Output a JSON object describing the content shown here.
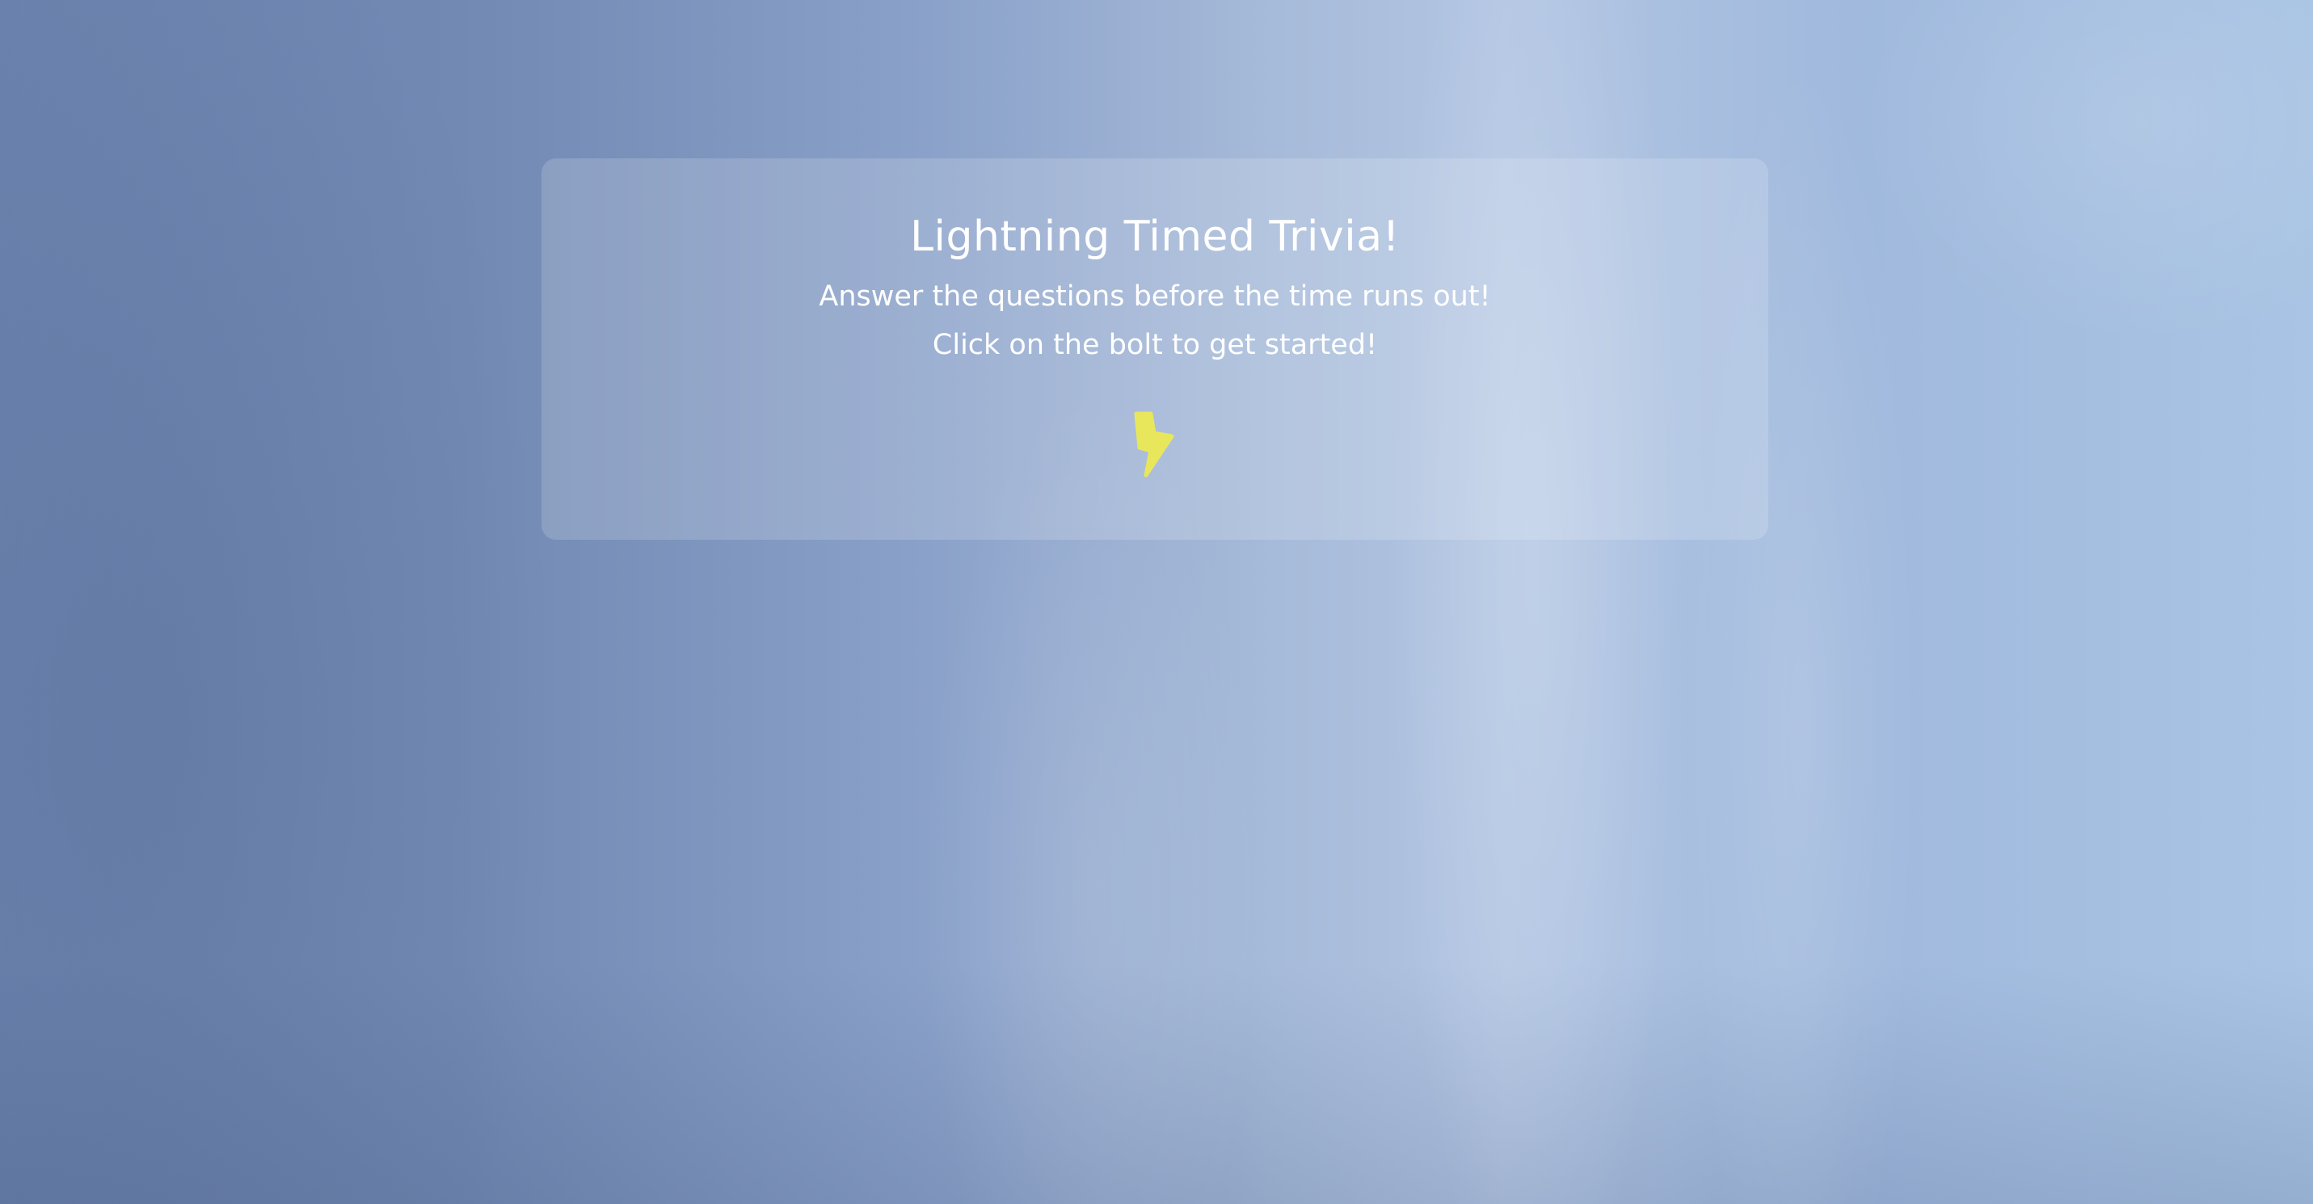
{
  "intro": {
    "title": "Lightning Timed Trivia!",
    "subtitle": "Answer the questions before the time runs out!",
    "instruction": "Click on the bolt to get started!"
  },
  "start_button": {
    "icon": "lightning-bolt-icon",
    "color": "#e8e75c"
  },
  "background": {
    "accent": "#8aa1c9"
  }
}
